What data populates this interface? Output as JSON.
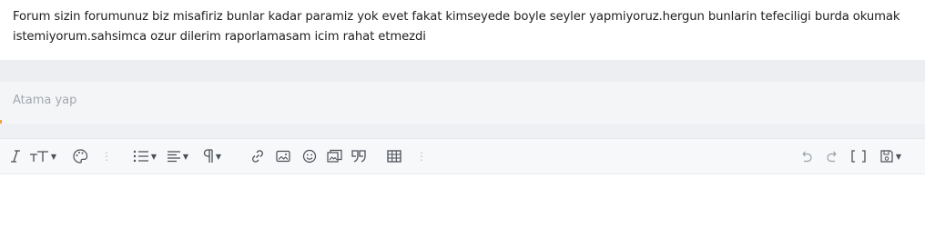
{
  "post": {
    "text": "Forum sizin forumunuz biz misafiriz bunlar kadar paramiz yok evet fakat kimseyede boyle seyler yapmiyoruz.hergun bunlarin tefeciligi burda okumak istemiyorum.sahsimca ozur dilerim raporlamasam icim rahat etmezdi"
  },
  "assign": {
    "placeholder": "Atama yap"
  },
  "toolbar": {
    "left_tools": [
      "italic-icon",
      "text-size-icon",
      "palette-icon",
      "more-vertical-icon",
      "list-icon",
      "align-icon",
      "paragraph-icon",
      "link-icon",
      "image-icon",
      "smiley-icon",
      "media-icon",
      "quote-icon",
      "table-icon",
      "more-vertical-icon"
    ],
    "right_tools": [
      "undo-icon",
      "redo-icon",
      "bbcode-icon",
      "save-draft-icon"
    ],
    "accent_color": "#f2a23a"
  }
}
